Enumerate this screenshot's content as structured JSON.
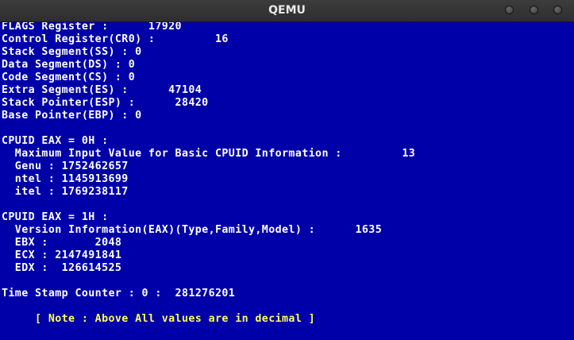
{
  "window": {
    "title": "QEMU"
  },
  "colors": {
    "screen_bg": "#0000a8",
    "text": "#ffffff",
    "note": "#ffff55"
  },
  "console_lines": [
    "FLAGS Register :      17920",
    "Control Register(CR0) :         16",
    "Stack Segment(SS) : 0",
    "Data Segment(DS) : 0",
    "Code Segment(CS) : 0",
    "Extra Segment(ES) :      47104",
    "Stack Pointer(ESP) :      28420",
    "Base Pointer(EBP) : 0",
    "",
    "CPUID EAX = 0H :",
    "  Maximum Input Value for Basic CPUID Information :         13",
    "  Genu : 1752462657",
    "  ntel : 1145913699",
    "  itel : 1769238117",
    "",
    "CPUID EAX = 1H :",
    "  Version Information(EAX)(Type,Family,Model) :      1635",
    "  EBX :       2048",
    "  ECX : 2147491841",
    "  EDX :  126614525",
    "",
    "Time Stamp Counter : 0 :  281276201",
    "",
    "     [ Note : Above All values are in decimal ]"
  ]
}
